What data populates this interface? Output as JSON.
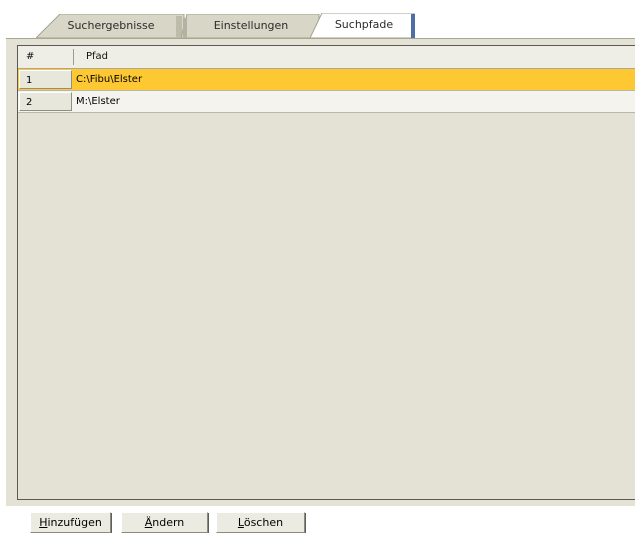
{
  "tabs": [
    {
      "label": "Suchergebnisse",
      "active": false
    },
    {
      "label": "Einstellungen",
      "active": false
    },
    {
      "label": "Suchpfade",
      "active": true
    }
  ],
  "table": {
    "columns": [
      "#",
      "Pfad"
    ],
    "rows": [
      {
        "num": "1",
        "path": "C:\\Fibu\\Elster",
        "selected": true
      },
      {
        "num": "2",
        "path": "M:\\Elster",
        "selected": false
      }
    ]
  },
  "buttons": {
    "add": {
      "hotkey": "H",
      "rest": "inzufügen"
    },
    "edit": {
      "hotkey": "Ä",
      "rest": "ndern"
    },
    "delete": {
      "hotkey": "L",
      "rest": "öschen"
    }
  },
  "colors": {
    "selected_row": "#fec832",
    "panel_bg": "#e3e2d5",
    "row_bg": "#f4f3ee"
  }
}
